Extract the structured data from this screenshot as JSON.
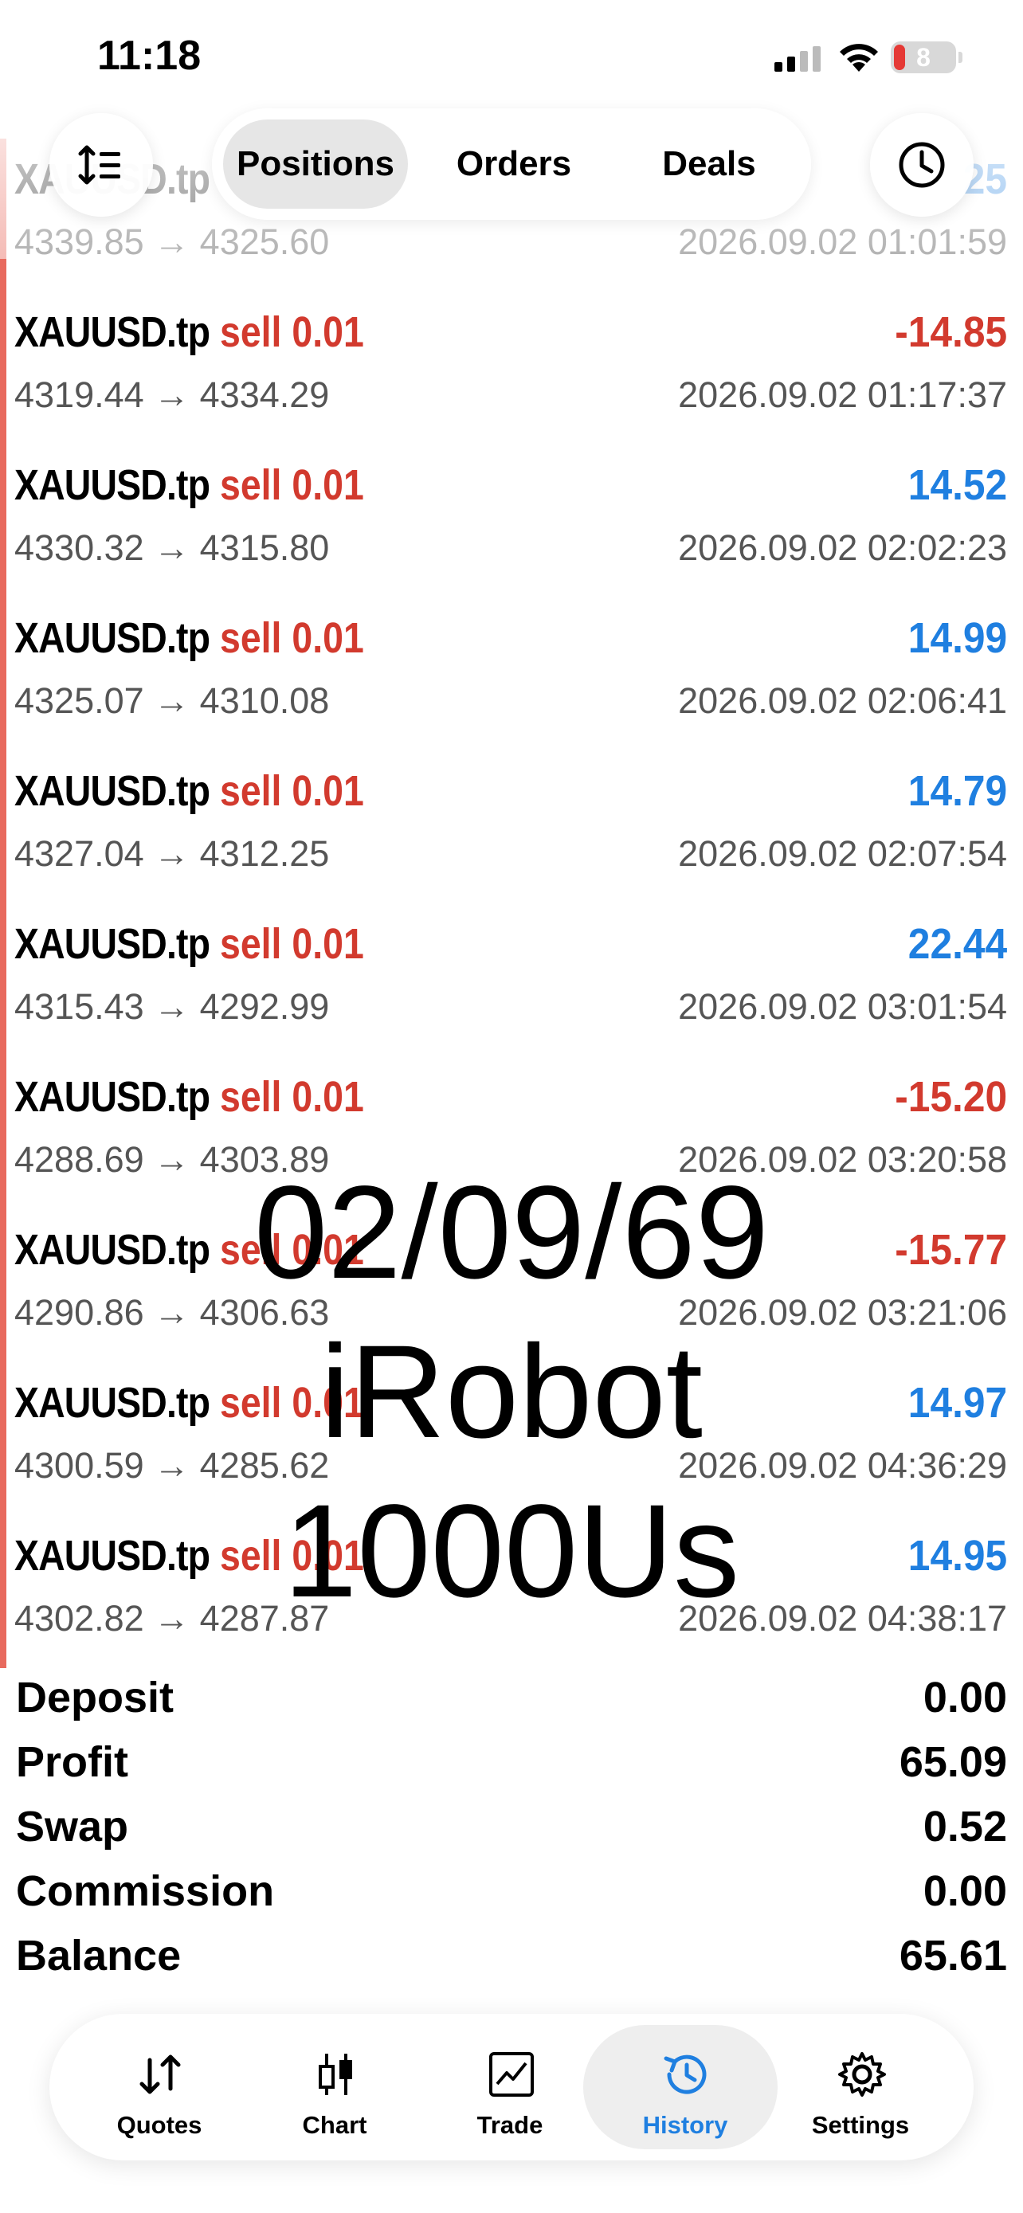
{
  "status_bar": {
    "time": "11:18",
    "battery": "8"
  },
  "top_tabs": [
    "Positions",
    "Orders",
    "Deals"
  ],
  "deals": [
    {
      "symbol": "XAUUSD.tp",
      "side": "",
      "volume": "",
      "profit": "25",
      "prices": "4339.85 → 4325.60",
      "time": "2026.09.02 01:01:59",
      "profit_sign": "pos"
    },
    {
      "symbol": "XAUUSD.tp",
      "side": "sell",
      "volume": "0.01",
      "profit": "-14.85",
      "prices": "4319.44 → 4334.29",
      "time": "2026.09.02 01:17:37",
      "profit_sign": "neg"
    },
    {
      "symbol": "XAUUSD.tp",
      "side": "sell",
      "volume": "0.01",
      "profit": "14.52",
      "prices": "4330.32 → 4315.80",
      "time": "2026.09.02 02:02:23",
      "profit_sign": "pos"
    },
    {
      "symbol": "XAUUSD.tp",
      "side": "sell",
      "volume": "0.01",
      "profit": "14.99",
      "prices": "4325.07 → 4310.08",
      "time": "2026.09.02 02:06:41",
      "profit_sign": "pos"
    },
    {
      "symbol": "XAUUSD.tp",
      "side": "sell",
      "volume": "0.01",
      "profit": "14.79",
      "prices": "4327.04 → 4312.25",
      "time": "2026.09.02 02:07:54",
      "profit_sign": "pos"
    },
    {
      "symbol": "XAUUSD.tp",
      "side": "sell",
      "volume": "0.01",
      "profit": "22.44",
      "prices": "4315.43 → 4292.99",
      "time": "2026.09.02 03:01:54",
      "profit_sign": "pos"
    },
    {
      "symbol": "XAUUSD.tp",
      "side": "sell",
      "volume": "0.01",
      "profit": "-15.20",
      "prices": "4288.69 → 4303.89",
      "time": "2026.09.02 03:20:58",
      "profit_sign": "neg"
    },
    {
      "symbol": "XAUUSD.tp",
      "side": "sell",
      "volume": "0.01",
      "profit": "-15.77",
      "prices": "4290.86 → 4306.63",
      "time": "2026.09.02 03:21:06",
      "profit_sign": "neg"
    },
    {
      "symbol": "XAUUSD.tp",
      "side": "sell",
      "volume": "0.01",
      "profit": "14.97",
      "prices": "4300.59 → 4285.62",
      "time": "2026.09.02 04:36:29",
      "profit_sign": "pos"
    },
    {
      "symbol": "XAUUSD.tp",
      "side": "sell",
      "volume": "0.01",
      "profit": "14.95",
      "prices": "4302.82 → 4287.87",
      "time": "2026.09.02 04:38:17",
      "profit_sign": "pos"
    }
  ],
  "summary": [
    {
      "label": "Deposit",
      "value": "0.00"
    },
    {
      "label": "Profit",
      "value": "65.09"
    },
    {
      "label": "Swap",
      "value": "0.52"
    },
    {
      "label": "Commission",
      "value": "0.00"
    },
    {
      "label": "Balance",
      "value": "65.61"
    }
  ],
  "overlay_lines": [
    "02/09/69",
    "iRobot",
    "1000Us"
  ],
  "bottom_tabs": [
    "Quotes",
    "Chart",
    "Trade",
    "History",
    "Settings"
  ],
  "colors": {
    "profit_positive": "#1f7fe0",
    "loss_negative": "#d23a2e",
    "active_tab": "#1f7fe0"
  }
}
